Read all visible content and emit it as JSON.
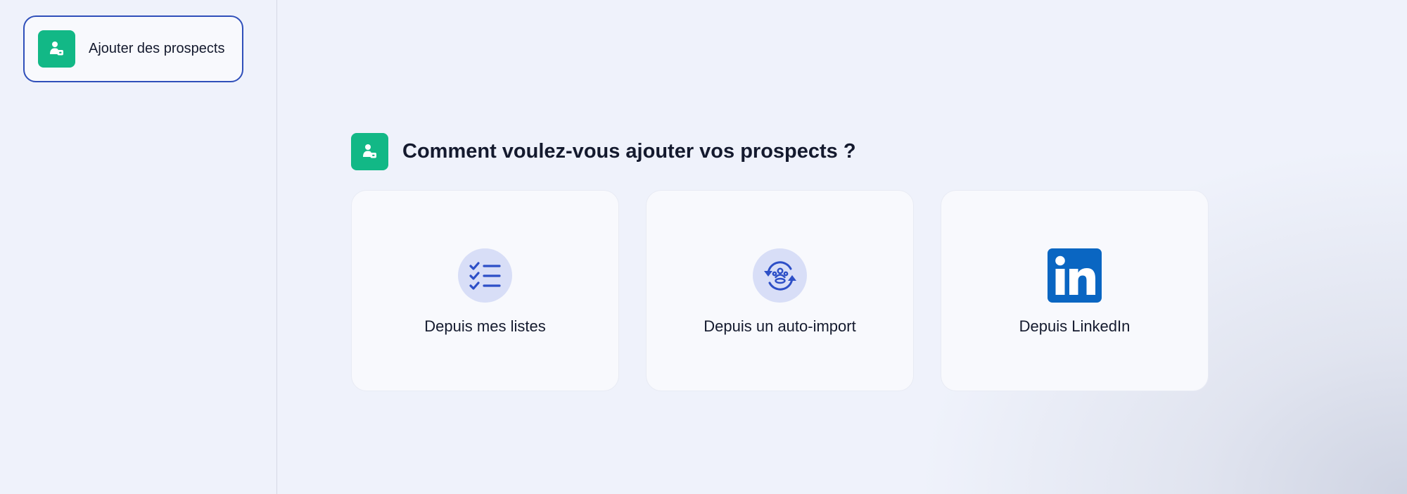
{
  "sidebar": {
    "step": {
      "label": "Ajouter des prospects",
      "icon": "user-add-icon"
    }
  },
  "main": {
    "header": {
      "title": "Comment voulez-vous ajouter vos prospects ?",
      "icon": "user-add-icon"
    },
    "options": [
      {
        "label": "Depuis mes listes",
        "icon": "checklist-icon"
      },
      {
        "label": "Depuis un auto-import",
        "icon": "sync-users-icon"
      },
      {
        "label": "Depuis LinkedIn",
        "icon": "linkedin-icon"
      }
    ]
  },
  "colors": {
    "accent_green": "#12b886",
    "selected_border": "#2f4fba",
    "icon_blue": "#2d4fc7",
    "linkedin_blue": "#0a66c2",
    "icon_circle_bg": "#d8def7"
  }
}
